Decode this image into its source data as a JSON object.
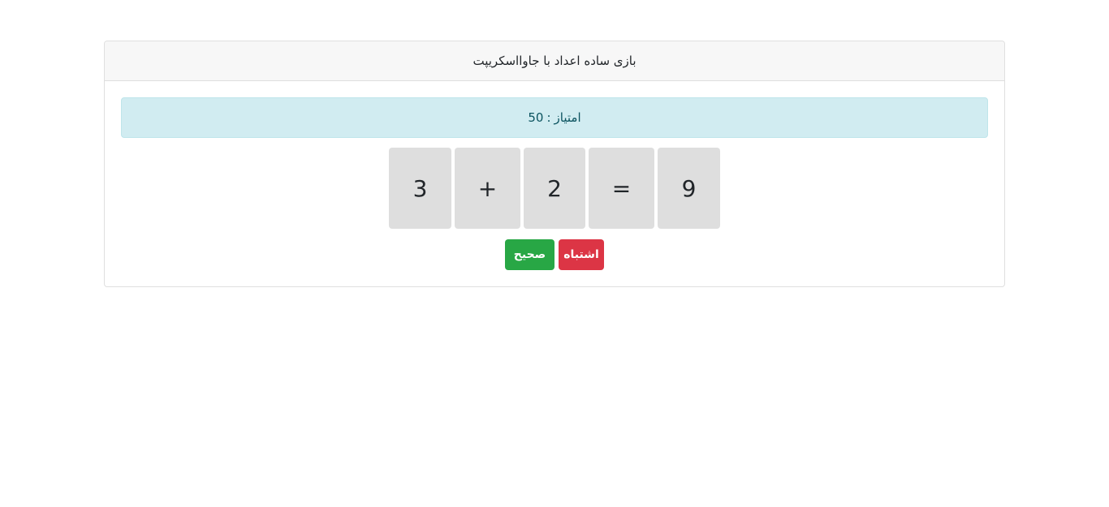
{
  "header": {
    "title": "بازی ساده اعداد با جاوااسکریپت"
  },
  "score": {
    "label": "امتیاز",
    "separator": ":",
    "value": "50"
  },
  "equation": {
    "tiles": [
      "9",
      "=",
      "2",
      "+",
      "3"
    ]
  },
  "buttons": {
    "wrong_label": "اشتباه",
    "correct_label": "صحیح"
  },
  "colors": {
    "wrong": "#dc3545",
    "correct": "#28a745",
    "alert_bg": "#d1ecf1",
    "tile_bg": "#dedede"
  }
}
